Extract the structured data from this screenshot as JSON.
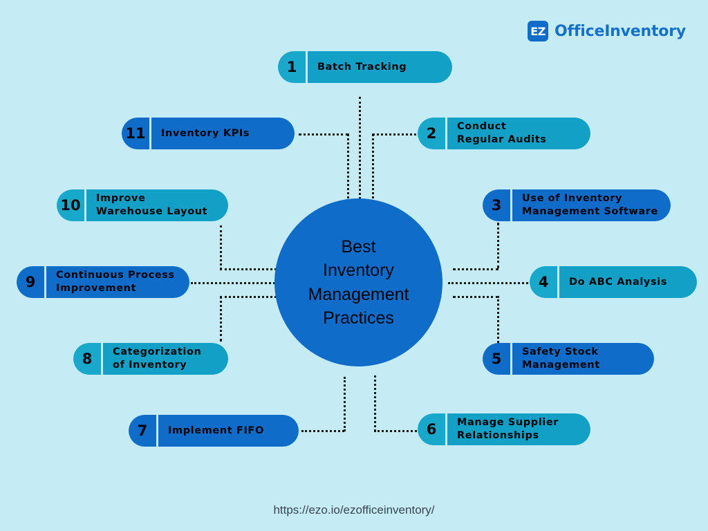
{
  "brand": {
    "mark_text": "EZ",
    "name": "OfficeInventory",
    "mark_color": "#0f6cc9",
    "text_color": "#1470c8"
  },
  "canvas": {
    "background": "#c5ecf5",
    "connector_color": "#1a1a1a"
  },
  "hub": {
    "title": "Best\nInventory\nManagement\nPractices",
    "fill": "#0f6cc9",
    "text_color": "#000000"
  },
  "nodes": [
    {
      "number": "1",
      "label": "Batch Tracking",
      "style": "cyan",
      "num_side": "left"
    },
    {
      "number": "2",
      "label": "Conduct\nRegular Audits",
      "style": "cyan",
      "num_side": "left"
    },
    {
      "number": "3",
      "label": "Use of Inventory\nManagement Software",
      "style": "blue",
      "num_side": "left"
    },
    {
      "number": "4",
      "label": "Do ABC Analysis",
      "style": "cyan",
      "num_side": "left"
    },
    {
      "number": "5",
      "label": "Safety Stock\nManagement",
      "style": "blue",
      "num_side": "left"
    },
    {
      "number": "6",
      "label": "Manage Supplier\nRelationships",
      "style": "cyan",
      "num_side": "left"
    },
    {
      "number": "7",
      "label": "Implement FIFO",
      "style": "blue",
      "num_side": "left"
    },
    {
      "number": "8",
      "label": "Categorization\nof Inventory",
      "style": "cyan",
      "num_side": "left"
    },
    {
      "number": "9",
      "label": "Continuous Process\nImprovement",
      "style": "blue",
      "num_side": "left"
    },
    {
      "number": "10",
      "label": "Improve\nWarehouse Layout",
      "style": "cyan",
      "num_side": "left"
    },
    {
      "number": "11",
      "label": "Inventory KPIs",
      "style": "blue",
      "num_side": "left"
    }
  ],
  "footer": {
    "url": "https://ezo.io/ezofficeinventory/"
  }
}
